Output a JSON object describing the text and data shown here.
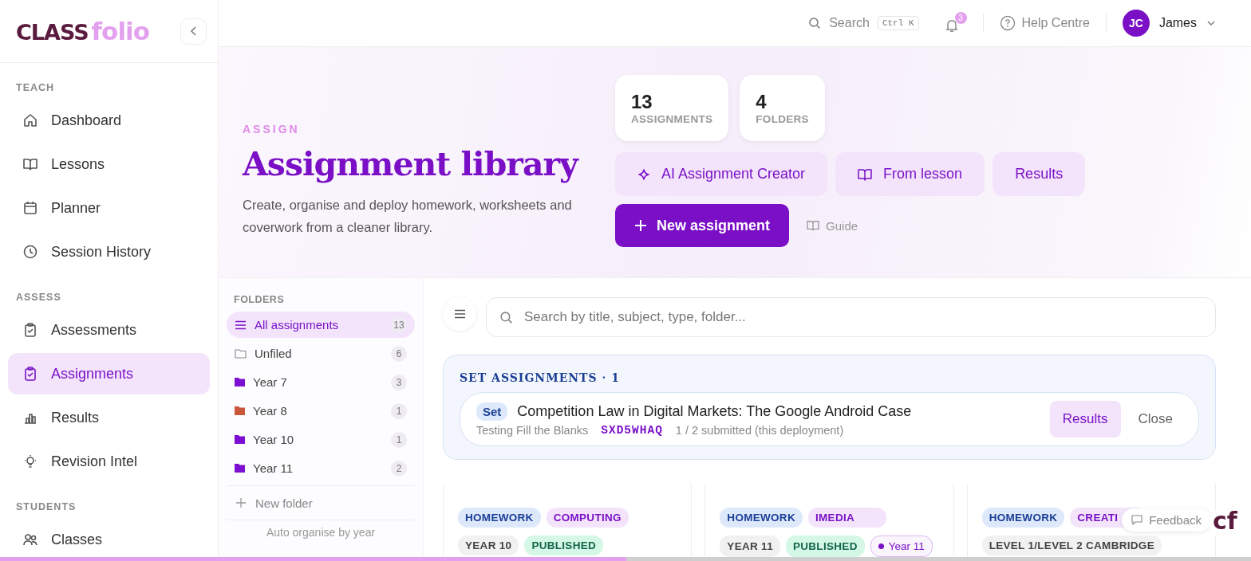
{
  "brand": {
    "part_1": "CLASS",
    "part_2": "folio"
  },
  "header": {
    "search_label": "Search",
    "search_shortcut": "Ctrl K",
    "notification_count": "3",
    "help": "Help Centre",
    "user_initials": "JC",
    "user_name": "James"
  },
  "sidebar": {
    "sections": [
      {
        "title": "TEACH",
        "items": [
          {
            "label": "Dashboard",
            "selected": false
          },
          {
            "label": "Lessons",
            "selected": false
          },
          {
            "label": "Planner",
            "selected": false
          },
          {
            "label": "Session History",
            "selected": false
          }
        ]
      },
      {
        "title": "ASSESS",
        "items": [
          {
            "label": "Assessments",
            "selected": false
          },
          {
            "label": "Assignments",
            "selected": true
          },
          {
            "label": "Results",
            "selected": false
          },
          {
            "label": "Revision Intel",
            "selected": false
          }
        ]
      },
      {
        "title": "STUDENTS",
        "items": [
          {
            "label": "Classes",
            "selected": false
          }
        ]
      }
    ]
  },
  "hero": {
    "eyebrow": "ASSIGN",
    "title": "Assignment library",
    "description": "Create, organise and deploy homework, worksheets and coverwork from a cleaner library.",
    "stats": [
      {
        "value": "13",
        "label": "ASSIGNMENTS"
      },
      {
        "value": "4",
        "label": "FOLDERS"
      }
    ],
    "actions": [
      {
        "label": "AI Assignment Creator",
        "kind": "ai"
      },
      {
        "label": "From lesson",
        "kind": "lesson"
      },
      {
        "label": "Results",
        "kind": "plain"
      }
    ],
    "primary_action": "New assignment",
    "guide": "Guide"
  },
  "folders": {
    "title": "FOLDERS",
    "items": [
      {
        "label": "All assignments",
        "count": "13",
        "kind": "all",
        "selected": true
      },
      {
        "label": "Unfiled",
        "count": "6",
        "kind": "unfiled",
        "selected": false
      },
      {
        "label": "Year 7",
        "count": "3",
        "kind": "folder",
        "color": "#7c0fd1",
        "selected": false
      },
      {
        "label": "Year 8",
        "count": "1",
        "kind": "folder",
        "color": "#c9573a",
        "selected": false
      },
      {
        "label": "Year 10",
        "count": "1",
        "kind": "folder",
        "color": "#7c0fd1",
        "selected": false
      },
      {
        "label": "Year 11",
        "count": "2",
        "kind": "folder",
        "color": "#7c0fd1",
        "selected": false
      }
    ],
    "new_folder": "New folder",
    "auto_organise": "Auto organise by year"
  },
  "search": {
    "placeholder": "Search by title, subject, type, folder..."
  },
  "set_assignments": {
    "title": "SET ASSIGNMENTS · 1",
    "items": [
      {
        "status": "Set",
        "title": "Competition Law in Digital Markets: The Google Android Case",
        "type": "Testing Fill the Blanks",
        "code": "SXD5WHAQ",
        "submitted": "1 / 2 submitted (this deployment)",
        "results": "Results",
        "close": "Close"
      }
    ]
  },
  "cards": [
    {
      "tags": [
        {
          "label": "HOMEWORK",
          "kind": "type"
        },
        {
          "label": "COMPUTING",
          "kind": "subject"
        },
        {
          "label": "YEAR 10",
          "kind": "year"
        },
        {
          "label": "PUBLISHED",
          "kind": "status"
        }
      ]
    },
    {
      "tags": [
        {
          "label": "HOMEWORK",
          "kind": "type"
        },
        {
          "label": "IMEDIA",
          "kind": "subject"
        },
        {
          "label": "YEAR 11",
          "kind": "year"
        },
        {
          "label": "PUBLISHED",
          "kind": "status"
        },
        {
          "label": "Year 11",
          "kind": "class"
        }
      ]
    },
    {
      "tags": [
        {
          "label": "HOMEWORK",
          "kind": "type"
        },
        {
          "label": "CREATI",
          "kind": "subject"
        },
        {
          "label": "LEVEL 1/LEVEL 2 CAMBRIDGE",
          "kind": "year"
        }
      ]
    }
  ],
  "feedback": "Feedback",
  "widget": "cf"
}
